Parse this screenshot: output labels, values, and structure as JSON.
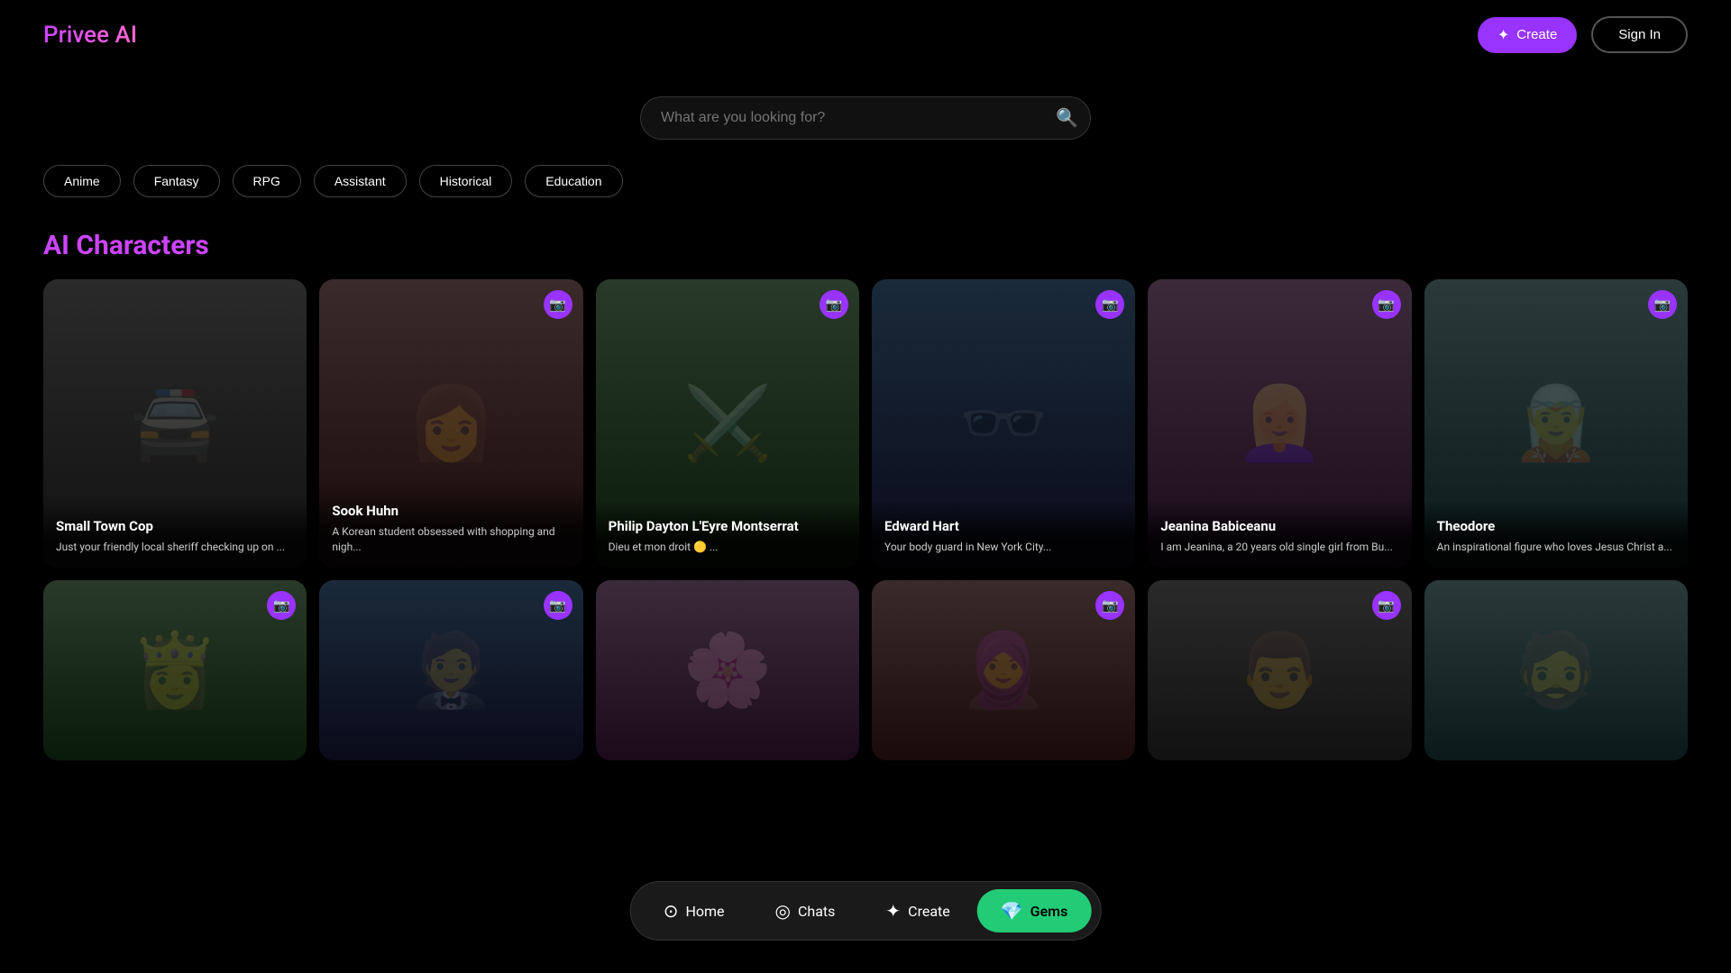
{
  "app": {
    "title": "Privee AI"
  },
  "header": {
    "logo": "Privee AI",
    "create_label": "Create",
    "signin_label": "Sign In"
  },
  "search": {
    "placeholder": "What are you looking for?"
  },
  "filters": [
    {
      "id": "anime",
      "label": "Anime"
    },
    {
      "id": "fantasy",
      "label": "Fantasy"
    },
    {
      "id": "rpg",
      "label": "RPG"
    },
    {
      "id": "assistant",
      "label": "Assistant"
    },
    {
      "id": "historical",
      "label": "Historical"
    },
    {
      "id": "education",
      "label": "Education"
    }
  ],
  "section_title": "AI Characters",
  "cards_row1": [
    {
      "id": "small-town-cop",
      "name": "Small Town Cop",
      "desc": "Just your friendly local sheriff checking up on ...",
      "has_camera": false,
      "art": "🚔"
    },
    {
      "id": "sook-huhn",
      "name": "Sook Huhn",
      "desc": "A Korean student obsessed with shopping and nigh...",
      "has_camera": true,
      "art": "👩"
    },
    {
      "id": "philip-dayton",
      "name": "Philip Dayton L'Eyre Montserrat",
      "desc": "Dieu et mon droit 🟡 ...",
      "has_camera": true,
      "art": "⚔️"
    },
    {
      "id": "edward-hart",
      "name": "Edward Hart",
      "desc": "Your body guard in New York City...",
      "has_camera": true,
      "art": "🕶️"
    },
    {
      "id": "jeanina-babiceanu",
      "name": "Jeanina Babiceanu",
      "desc": "I am Jeanina, a 20 years old single girl from Bu...",
      "has_camera": true,
      "art": "👱‍♀️"
    },
    {
      "id": "theodore",
      "name": "Theodore",
      "desc": "An inspirational figure who loves Jesus Christ a...",
      "has_camera": true,
      "art": "🧝"
    }
  ],
  "cards_row2": [
    {
      "id": "card-r2-1",
      "name": "",
      "desc": "",
      "has_camera": true,
      "art": "👸"
    },
    {
      "id": "card-r2-2",
      "name": "",
      "desc": "",
      "has_camera": true,
      "art": "🤵"
    },
    {
      "id": "card-r2-3",
      "name": "",
      "desc": "",
      "has_camera": false,
      "art": "🌸"
    },
    {
      "id": "card-r2-4",
      "name": "",
      "desc": "",
      "has_camera": true,
      "art": "🧕"
    },
    {
      "id": "card-r2-5",
      "name": "",
      "desc": "",
      "has_camera": true,
      "art": "👨"
    },
    {
      "id": "card-r2-6",
      "name": "",
      "desc": "",
      "has_camera": false,
      "art": "🧔"
    }
  ],
  "bottom_nav": [
    {
      "id": "home",
      "label": "Home",
      "icon": "⊙",
      "active": false
    },
    {
      "id": "chats",
      "label": "Chats",
      "icon": "◎",
      "active": false
    },
    {
      "id": "create",
      "label": "Create",
      "icon": "✦",
      "active": false
    },
    {
      "id": "gems",
      "label": "Gems",
      "icon": "💎",
      "active": true
    }
  ],
  "colors": {
    "accent_purple": "#9933ff",
    "accent_green": "#22cc77",
    "text_primary": "#ffffff",
    "text_secondary": "#cccccc",
    "bg_dark": "#000000",
    "bg_card": "#1a1a1a"
  }
}
